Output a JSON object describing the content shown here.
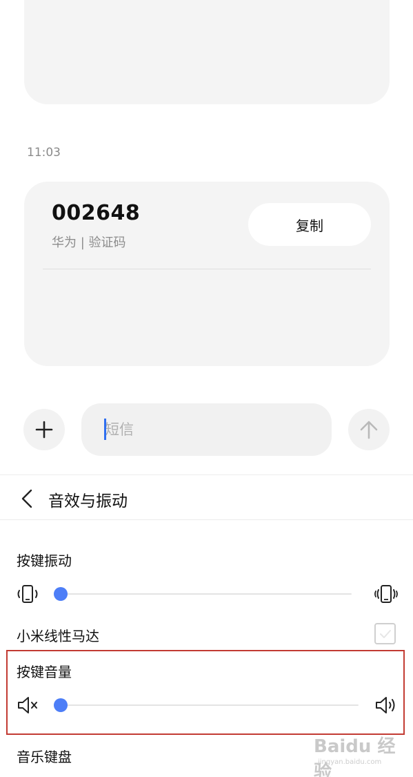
{
  "conversation": {
    "timestamp": "11:03",
    "code_card": {
      "code": "002648",
      "subtitle": "华为 | 验证码",
      "copy_label": "复制"
    }
  },
  "composer": {
    "placeholder": "短信",
    "add_icon": "plus-icon",
    "send_icon": "arrow-up-icon"
  },
  "settings": {
    "back_icon": "chevron-left-icon",
    "title": "音效与振动",
    "key_vibration": {
      "label": "按键振动",
      "level": 0.0,
      "left_icon": "vibrate-low-icon",
      "right_icon": "vibrate-high-icon"
    },
    "linear_motor": {
      "label": "小米线性马达",
      "checked": false
    },
    "key_volume": {
      "label": "按键音量",
      "level": 0.0,
      "left_icon": "volume-mute-icon",
      "right_icon": "volume-high-icon"
    },
    "music_keyboard": {
      "label": "音乐键盘"
    }
  },
  "watermark": {
    "logo": "Baidu 经验",
    "url": "jingyan.baidu.com"
  },
  "colors": {
    "accent": "#4d7ef7",
    "highlight": "#c23a32",
    "card_bg": "#f4f4f4"
  }
}
